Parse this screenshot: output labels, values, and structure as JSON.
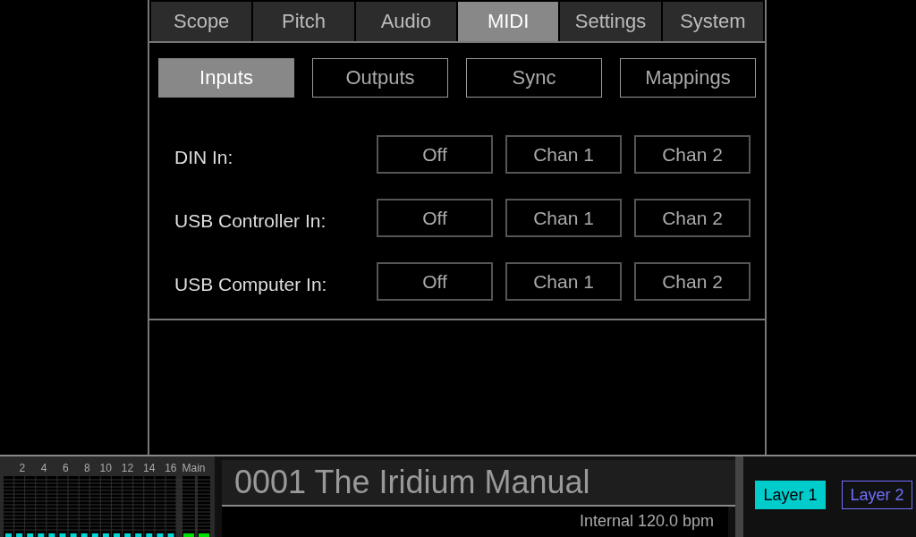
{
  "tabs": [
    {
      "label": "Scope",
      "selected": false
    },
    {
      "label": "Pitch",
      "selected": false
    },
    {
      "label": "Audio",
      "selected": false
    },
    {
      "label": "MIDI",
      "selected": true
    },
    {
      "label": "Settings",
      "selected": false
    },
    {
      "label": "System",
      "selected": false
    }
  ],
  "subtabs": [
    {
      "label": "Inputs",
      "selected": true
    },
    {
      "label": "Outputs",
      "selected": false
    },
    {
      "label": "Sync",
      "selected": false
    },
    {
      "label": "Mappings",
      "selected": false
    }
  ],
  "inputs": [
    {
      "label": "DIN In:",
      "options": [
        "Off",
        "Chan 1",
        "Chan 2"
      ]
    },
    {
      "label": "USB Controller In:",
      "options": [
        "Off",
        "Chan 1",
        "Chan 2"
      ]
    },
    {
      "label": "USB Computer In:",
      "options": [
        "Off",
        "Chan 1",
        "Chan 2"
      ]
    }
  ],
  "mixer": {
    "channel_labels": [
      "2",
      "4",
      "6",
      "8",
      "10",
      "12",
      "14",
      "16"
    ],
    "main_label": "Main"
  },
  "patch": {
    "title": "0001 The Iridium Manual",
    "tempo": "Internal 120.0 bpm"
  },
  "layers": [
    {
      "label": "Layer 1",
      "selected": true
    },
    {
      "label": "Layer 2",
      "selected": false
    }
  ]
}
